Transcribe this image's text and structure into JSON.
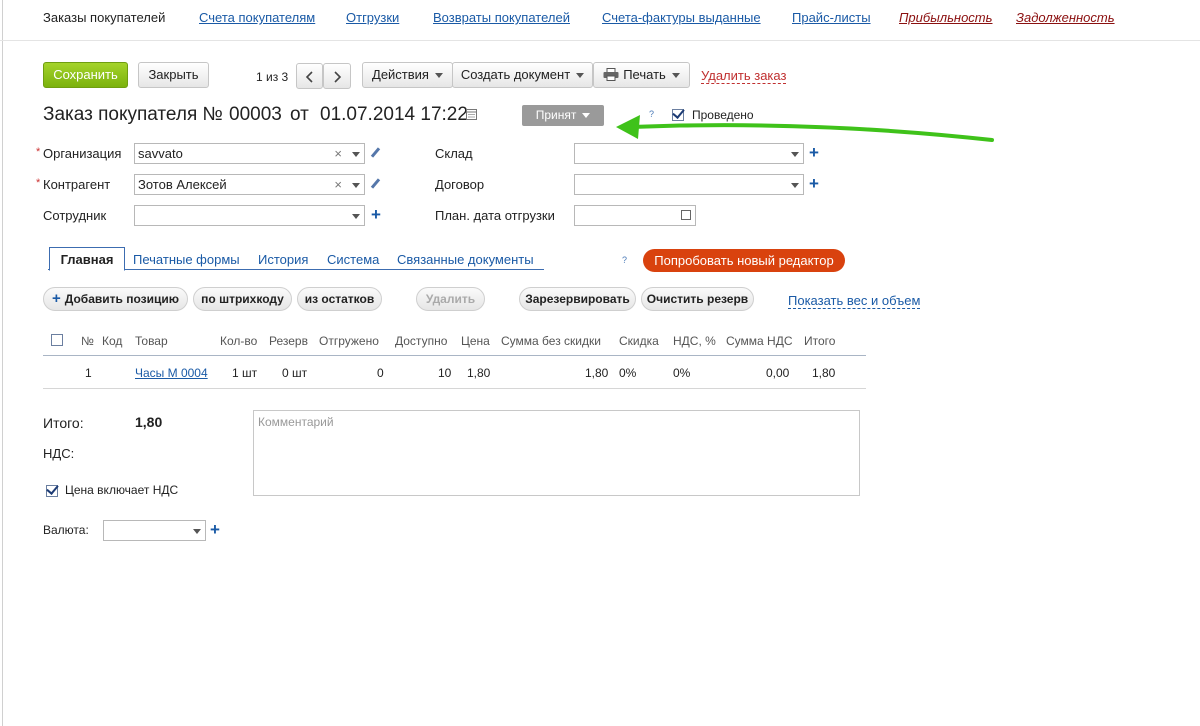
{
  "nav": {
    "current": "Заказы покупателей",
    "links": [
      "Счета покупателям",
      "Отгрузки",
      "Возвраты покупателей",
      "Счета-фактуры выданные",
      "Прайс-листы"
    ],
    "red_links": [
      "Прибыльность",
      "Задолженность"
    ]
  },
  "toolbar": {
    "save": "Сохранить",
    "close": "Закрыть",
    "pager": "1 из 3",
    "actions": "Действия",
    "create_doc": "Создать документ",
    "print": "Печать",
    "delete_order": "Удалить заказ"
  },
  "header": {
    "title_prefix": "Заказ покупателя №",
    "number": "00003",
    "from": "от",
    "datetime": "01.07.2014 17:22",
    "status": "Принят",
    "help": "?",
    "posted_label": "Проведено",
    "posted": true
  },
  "form": {
    "organization_label": "Организация",
    "organization_value": "savvato",
    "counterparty_label": "Контрагент",
    "counterparty_value": "Зотов Алексей",
    "employee_label": "Сотрудник",
    "employee_value": "",
    "warehouse_label": "Склад",
    "warehouse_value": "",
    "contract_label": "Договор",
    "contract_value": "",
    "ship_date_label": "План. дата отгрузки",
    "ship_date_value": ""
  },
  "tabs": [
    "Главная",
    "Печатные формы",
    "История",
    "Система",
    "Связанные документы"
  ],
  "new_editor": "Попробовать новый редактор",
  "actions": {
    "add_position": "Добавить позицию",
    "by_barcode": "по штрихкоду",
    "from_stock": "из остатков",
    "delete": "Удалить",
    "reserve": "Зарезервировать",
    "clear_reserve": "Очистить резерв",
    "show_weight": "Показать вес и объем"
  },
  "table": {
    "headers": [
      "№",
      "Код",
      "Товар",
      "Кол-во",
      "Резерв",
      "Отгружено",
      "Доступно",
      "Цена",
      "Сумма без скидки",
      "Скидка",
      "НДС, %",
      "Сумма НДС",
      "Итого"
    ],
    "rows": [
      {
        "num": "1",
        "code": "",
        "product": "Часы М 0004",
        "qty": "1 шт",
        "reserve": "0 шт",
        "shipped": "0",
        "available": "10",
        "price": "1,80",
        "sum": "1,80",
        "discount": "0%",
        "vat_pct": "0%",
        "vat_sum": "0,00",
        "total": "1,80"
      }
    ]
  },
  "totals": {
    "total_label": "Итого:",
    "total_value": "1,80",
    "vat_label": "НДС:",
    "price_incl_vat_label": "Цена включает НДС",
    "price_incl_vat": true,
    "currency_label": "Валюта:",
    "currency_value": ""
  },
  "comment_placeholder": "Комментарий",
  "colors": {
    "accent": "#1a5aa6",
    "save_green": "#8cc31a",
    "new_editor": "#d9420e",
    "annotation_arrow": "#3fc21a"
  }
}
